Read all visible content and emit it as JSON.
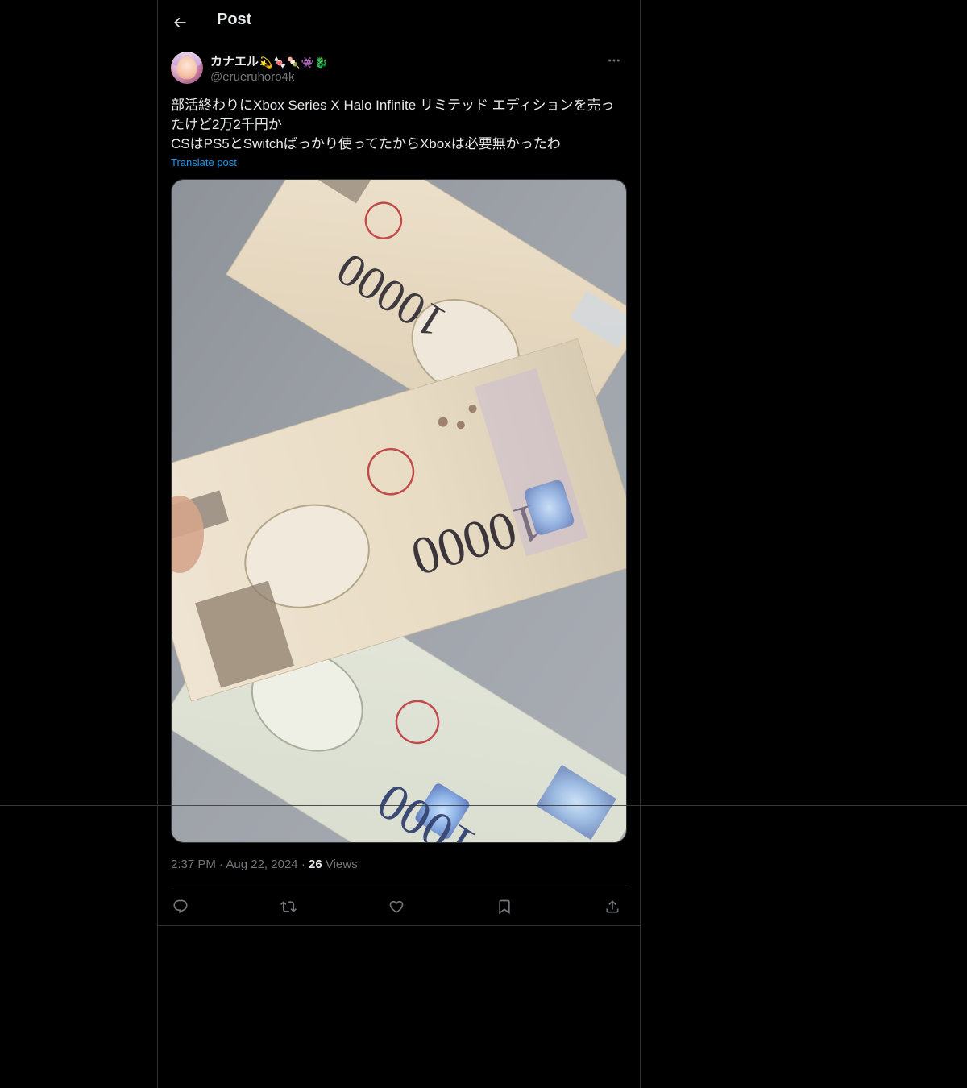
{
  "header": {
    "title": "Post",
    "back_icon": "arrow-left-icon"
  },
  "author": {
    "display_name": "カナエル",
    "emojis": [
      "💫",
      "🍬",
      "🍡",
      "👾",
      "🐉"
    ],
    "handle": "@erueruhoro4k"
  },
  "post": {
    "text": "部活終わりにXbox Series X Halo Infinite リミテッド エディションを売ったけど2万2千円か\nCSはPS5とSwitchばっかり使ってたからXboxは必要無かったわ",
    "translate_label": "Translate post"
  },
  "meta": {
    "time": "2:37 PM",
    "separator": "·",
    "date": "Aug 22, 2024",
    "views_count": "26",
    "views_label": "Views"
  },
  "actions": [
    {
      "name": "reply",
      "icon": "reply-icon"
    },
    {
      "name": "repost",
      "icon": "repost-icon"
    },
    {
      "name": "like",
      "icon": "heart-icon"
    },
    {
      "name": "bookmark",
      "icon": "bookmark-icon"
    },
    {
      "name": "share",
      "icon": "share-icon"
    }
  ],
  "colors": {
    "background": "#000000",
    "text": "#e7e9ea",
    "secondary": "#71767b",
    "accent": "#1d9bf0",
    "border": "#2f3336"
  }
}
